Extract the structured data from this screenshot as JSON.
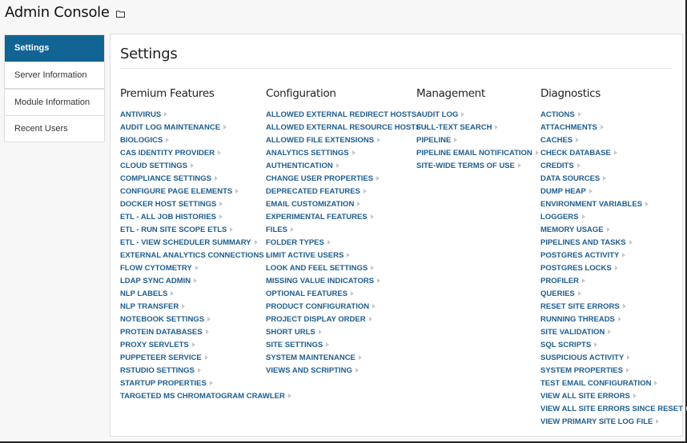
{
  "header": {
    "title": "Admin Console",
    "icon": "folder-icon"
  },
  "sidebar": {
    "items": [
      {
        "label": "Settings",
        "active": true
      },
      {
        "label": "Server Information",
        "active": false
      },
      {
        "label": "Module Information",
        "active": false
      },
      {
        "label": "Recent Users",
        "active": false
      }
    ]
  },
  "colors": {
    "accent": "#126495",
    "link": "#1e5d8f",
    "background": "#f7f7f7"
  },
  "main": {
    "title": "Settings",
    "sections": [
      {
        "title": "Premium Features",
        "links": [
          "ANTIVIRUS",
          "AUDIT LOG MAINTENANCE",
          "BIOLOGICS",
          "CAS IDENTITY PROVIDER",
          "CLOUD SETTINGS",
          "COMPLIANCE SETTINGS",
          "CONFIGURE PAGE ELEMENTS",
          "DOCKER HOST SETTINGS",
          "ETL - ALL JOB HISTORIES",
          "ETL - RUN SITE SCOPE ETLS",
          "ETL - VIEW SCHEDULER SUMMARY",
          "EXTERNAL ANALYTICS CONNECTIONS",
          "FLOW CYTOMETRY",
          "LDAP SYNC ADMIN",
          "NLP LABELS",
          "NLP TRANSFER",
          "NOTEBOOK SETTINGS",
          "PROTEIN DATABASES",
          "PROXY SERVLETS",
          "PUPPETEER SERVICE",
          "RSTUDIO SETTINGS",
          "STARTUP PROPERTIES",
          "TARGETED MS CHROMATOGRAM CRAWLER"
        ]
      },
      {
        "title": "Configuration",
        "links": [
          "ALLOWED EXTERNAL REDIRECT HOSTS",
          "ALLOWED EXTERNAL RESOURCE HOSTS",
          "ALLOWED FILE EXTENSIONS",
          "ANALYTICS SETTINGS",
          "AUTHENTICATION",
          "CHANGE USER PROPERTIES",
          "DEPRECATED FEATURES",
          "EMAIL CUSTOMIZATION",
          "EXPERIMENTAL FEATURES",
          "FILES",
          "FOLDER TYPES",
          "LIMIT ACTIVE USERS",
          "LOOK AND FEEL SETTINGS",
          "MISSING VALUE INDICATORS",
          "OPTIONAL FEATURES",
          "PRODUCT CONFIGURATION",
          "PROJECT DISPLAY ORDER",
          "SHORT URLS",
          "SITE SETTINGS",
          "SYSTEM MAINTENANCE",
          "VIEWS AND SCRIPTING"
        ]
      },
      {
        "title": "Management",
        "links": [
          "AUDIT LOG",
          "FULL-TEXT SEARCH",
          "PIPELINE",
          "PIPELINE EMAIL NOTIFICATION",
          "SITE-WIDE TERMS OF USE"
        ]
      },
      {
        "title": "Diagnostics",
        "links": [
          "ACTIONS",
          "ATTACHMENTS",
          "CACHES",
          "CHECK DATABASE",
          "CREDITS",
          "DATA SOURCES",
          "DUMP HEAP",
          "ENVIRONMENT VARIABLES",
          "LOGGERS",
          "MEMORY USAGE",
          "PIPELINES AND TASKS",
          "POSTGRES ACTIVITY",
          "POSTGRES LOCKS",
          "PROFILER",
          "QUERIES",
          "RESET SITE ERRORS",
          "RUNNING THREADS",
          "SITE VALIDATION",
          "SQL SCRIPTS",
          "SUSPICIOUS ACTIVITY",
          "SYSTEM PROPERTIES",
          "TEST EMAIL CONFIGURATION",
          "VIEW ALL SITE ERRORS",
          "VIEW ALL SITE ERRORS SINCE RESET",
          "VIEW PRIMARY SITE LOG FILE"
        ]
      }
    ]
  }
}
